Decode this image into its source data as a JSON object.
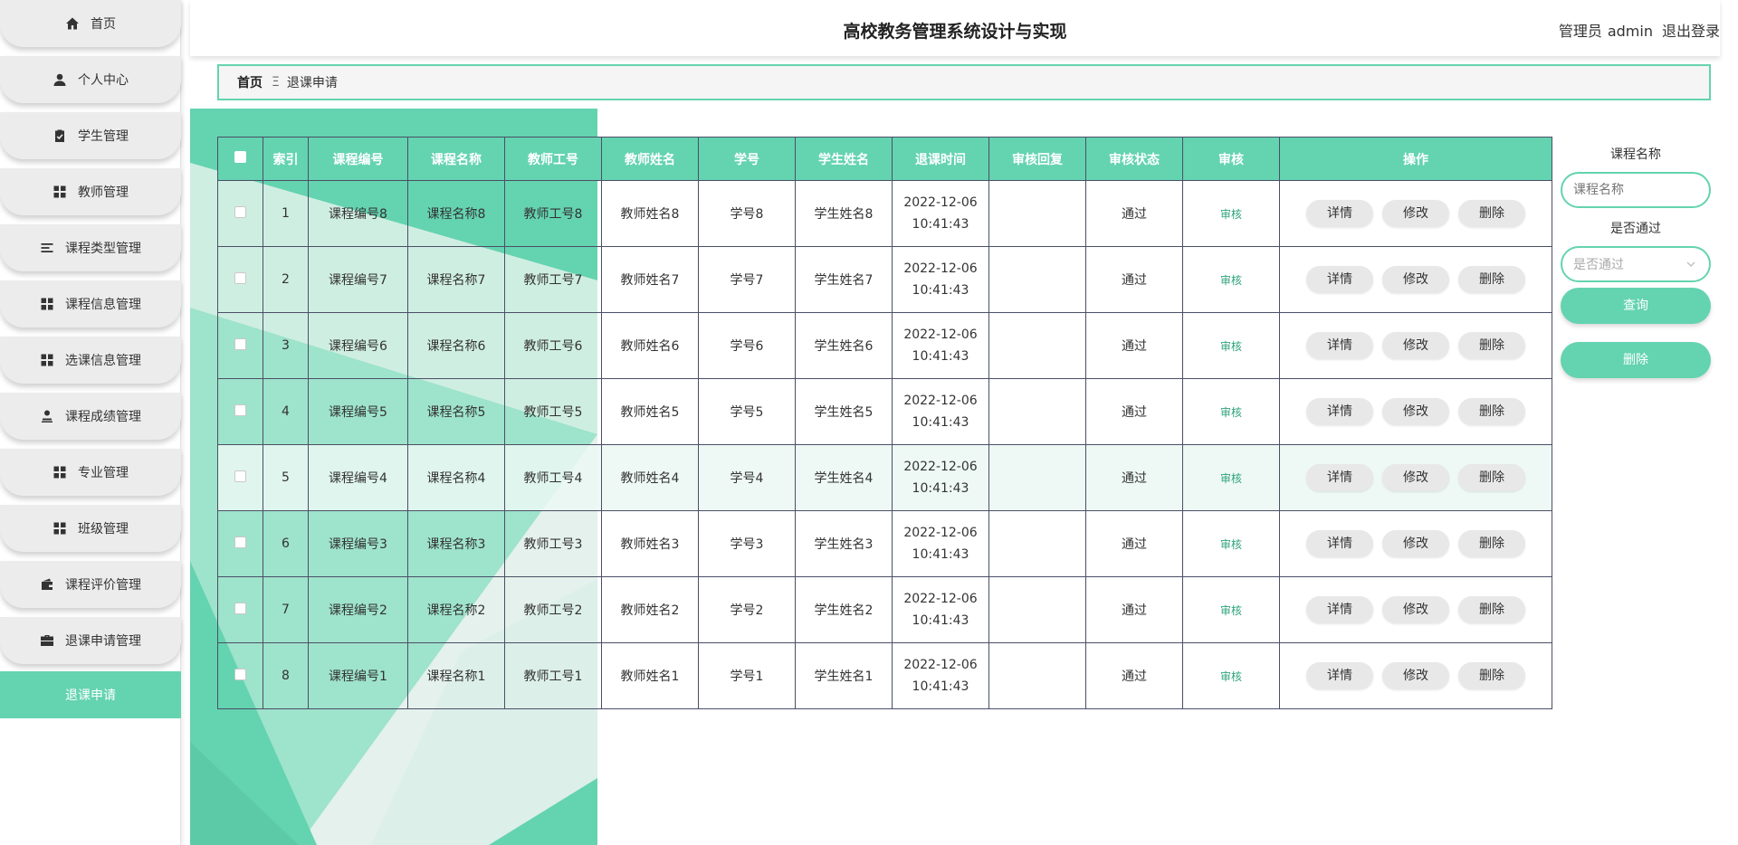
{
  "app": {
    "title": "高校教务管理系统设计与实现"
  },
  "user": {
    "role": "管理员",
    "name": "admin",
    "logout": "退出登录"
  },
  "sidebar": {
    "items": [
      {
        "label": "首页",
        "icon": "home-icon"
      },
      {
        "label": "个人中心",
        "icon": "user-icon"
      },
      {
        "label": "学生管理",
        "icon": "clipboard-icon"
      },
      {
        "label": "教师管理",
        "icon": "grid-icon"
      },
      {
        "label": "课程类型管理",
        "icon": "list-icon"
      },
      {
        "label": "课程信息管理",
        "icon": "grid-icon"
      },
      {
        "label": "选课信息管理",
        "icon": "grid-icon"
      },
      {
        "label": "课程成绩管理",
        "icon": "person-stamp-icon"
      },
      {
        "label": "专业管理",
        "icon": "grid-icon"
      },
      {
        "label": "班级管理",
        "icon": "grid-icon"
      },
      {
        "label": "课程评价管理",
        "icon": "wallet-icon"
      },
      {
        "label": "退课申请管理",
        "icon": "briefcase-icon"
      }
    ],
    "sub_item": "退课申请"
  },
  "breadcrumb": {
    "home": "首页",
    "sep": "Ξ",
    "current": "退课申请"
  },
  "table": {
    "headers": [
      "索引",
      "课程编号",
      "课程名称",
      "教师工号",
      "教师姓名",
      "学号",
      "学生姓名",
      "退课时间",
      "审核回复",
      "审核状态",
      "审核",
      "操作"
    ],
    "rows": [
      {
        "index": "1",
        "course_no": "课程编号8",
        "course_name": "课程名称8",
        "teacher_no": "教师工号8",
        "teacher_name": "教师姓名8",
        "student_no": "学号8",
        "student_name": "学生姓名8",
        "date": "2022-12-06",
        "time": "10:41:43",
        "reply": "",
        "status": "通过",
        "audit": "审核"
      },
      {
        "index": "2",
        "course_no": "课程编号7",
        "course_name": "课程名称7",
        "teacher_no": "教师工号7",
        "teacher_name": "教师姓名7",
        "student_no": "学号7",
        "student_name": "学生姓名7",
        "date": "2022-12-06",
        "time": "10:41:43",
        "reply": "",
        "status": "通过",
        "audit": "审核"
      },
      {
        "index": "3",
        "course_no": "课程编号6",
        "course_name": "课程名称6",
        "teacher_no": "教师工号6",
        "teacher_name": "教师姓名6",
        "student_no": "学号6",
        "student_name": "学生姓名6",
        "date": "2022-12-06",
        "time": "10:41:43",
        "reply": "",
        "status": "通过",
        "audit": "审核"
      },
      {
        "index": "4",
        "course_no": "课程编号5",
        "course_name": "课程名称5",
        "teacher_no": "教师工号5",
        "teacher_name": "教师姓名5",
        "student_no": "学号5",
        "student_name": "学生姓名5",
        "date": "2022-12-06",
        "time": "10:41:43",
        "reply": "",
        "status": "通过",
        "audit": "审核"
      },
      {
        "index": "5",
        "course_no": "课程编号4",
        "course_name": "课程名称4",
        "teacher_no": "教师工号4",
        "teacher_name": "教师姓名4",
        "student_no": "学号4",
        "student_name": "学生姓名4",
        "date": "2022-12-06",
        "time": "10:41:43",
        "reply": "",
        "status": "通过",
        "audit": "审核"
      },
      {
        "index": "6",
        "course_no": "课程编号3",
        "course_name": "课程名称3",
        "teacher_no": "教师工号3",
        "teacher_name": "教师姓名3",
        "student_no": "学号3",
        "student_name": "学生姓名3",
        "date": "2022-12-06",
        "time": "10:41:43",
        "reply": "",
        "status": "通过",
        "audit": "审核"
      },
      {
        "index": "7",
        "course_no": "课程编号2",
        "course_name": "课程名称2",
        "teacher_no": "教师工号2",
        "teacher_name": "教师姓名2",
        "student_no": "学号2",
        "student_name": "学生姓名2",
        "date": "2022-12-06",
        "time": "10:41:43",
        "reply": "",
        "status": "通过",
        "audit": "审核"
      },
      {
        "index": "8",
        "course_no": "课程编号1",
        "course_name": "课程名称1",
        "teacher_no": "教师工号1",
        "teacher_name": "教师姓名1",
        "student_no": "学号1",
        "student_name": "学生姓名1",
        "date": "2022-12-06",
        "time": "10:41:43",
        "reply": "",
        "status": "通过",
        "audit": "审核"
      }
    ],
    "actions": {
      "detail": "详情",
      "edit": "修改",
      "delete": "删除"
    }
  },
  "search": {
    "course_label": "课程名称",
    "course_placeholder": "课程名称",
    "pass_label": "是否通过",
    "pass_placeholder": "是否通过",
    "query_button": "查询",
    "delete_button": "删除"
  },
  "colors": {
    "accent": "#64d3b0",
    "grid": "#4b4f66",
    "nav_bg": "#ececec"
  }
}
